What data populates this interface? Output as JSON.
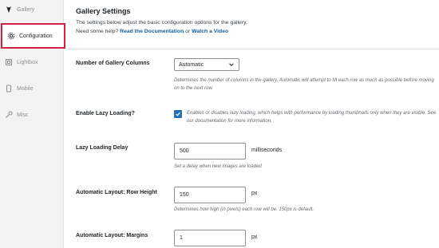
{
  "sidebar": {
    "items": [
      {
        "label": "Gallery",
        "icon": "gallery-icon"
      },
      {
        "label": "Configuration",
        "icon": "gear-icon"
      },
      {
        "label": "Lightbox",
        "icon": "lightbox-icon"
      },
      {
        "label": "Mobile",
        "icon": "mobile-icon"
      },
      {
        "label": "Misc",
        "icon": "wrench-icon"
      }
    ],
    "active_color": "#d6213f"
  },
  "header": {
    "title": "Gallery Settings",
    "description": "The settings below adjust the basic configuration options for the gallery.",
    "help_prefix": "Need some help?",
    "doc_link": "Read the Documentation",
    "or": "or",
    "video_link": "Watch a Video"
  },
  "settings": {
    "columns": {
      "label": "Number of Gallery Columns",
      "value": "Automatic",
      "hint": "Determines the number of columns in the gallery. Automatic will attempt to fill each row as much as possible before moving on to the next row."
    },
    "lazy_loading": {
      "label": "Enable Lazy Loading?",
      "checked": true,
      "hint": "Enables or disables lazy loading, which helps with performance by loading thumbnails only when they are visible. See our documentation for more information."
    },
    "lazy_delay": {
      "label": "Lazy Loading Delay",
      "value": "500",
      "unit": "milliseconds",
      "hint": "Set a delay when new images are loaded"
    },
    "row_height": {
      "label": "Automatic Layout: Row Height",
      "value": "150",
      "unit": "px",
      "hint": "Determines how high (in pixels) each row will be. 150px is default."
    },
    "margins": {
      "label": "Automatic Layout: Margins",
      "value": "1",
      "unit": "px"
    }
  },
  "colors": {
    "link": "#135e96",
    "checkbox": "#2271b1"
  }
}
